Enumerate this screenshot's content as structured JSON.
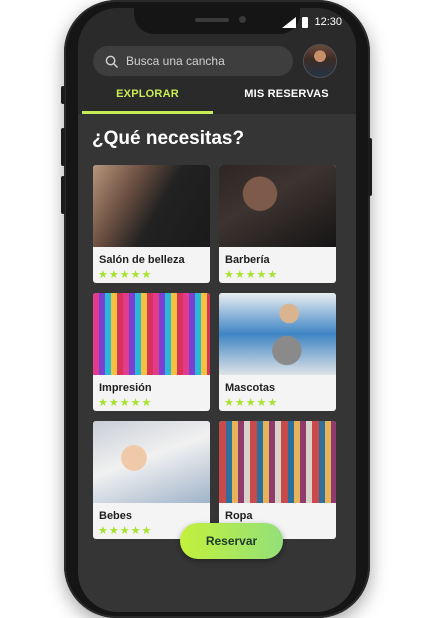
{
  "status_bar": {
    "time": "12:30"
  },
  "search": {
    "placeholder": "Busca una cancha"
  },
  "tabs": [
    {
      "label": "EXPLORAR",
      "active": true
    },
    {
      "label": "MIS RESERVAS",
      "active": false
    }
  ],
  "heading": "¿Qué necesitas?",
  "categories": [
    {
      "name": "Salón de belleza",
      "rating": 5
    },
    {
      "name": "Barbería",
      "rating": 5
    },
    {
      "name": "Impresión",
      "rating": 5
    },
    {
      "name": "Mascotas",
      "rating": 5
    },
    {
      "name": "Bebes",
      "rating": 5
    },
    {
      "name": "Ropa",
      "rating": 5
    }
  ],
  "stars_text": "★★★★★",
  "cta": {
    "label": "Reservar"
  },
  "colors": {
    "accent": "#c7ec55",
    "star": "#a6e22e",
    "background": "#353535"
  },
  "icons": {
    "search": "search-icon",
    "avatar": "user-avatar"
  }
}
